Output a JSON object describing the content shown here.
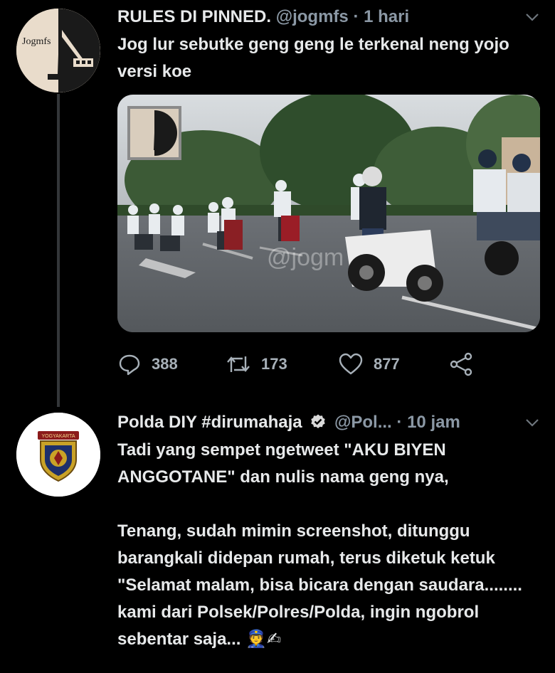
{
  "tweet1": {
    "avatar_text": "Jogmfs",
    "name": "RULES DI PINNED.",
    "handle": "@jogmfs",
    "separator": "·",
    "time": "1 hari",
    "text": "Jog lur sebutke geng geng le terkenal neng yojo versi koe",
    "media_watermark": "@jogm",
    "actions": {
      "reply_count": "388",
      "retweet_count": "173",
      "like_count": "877"
    }
  },
  "tweet2": {
    "name": "Polda DIY #dirumahaja",
    "handle": "@Pol...",
    "separator": "·",
    "time": "10 jam",
    "badge_text": "YOGYAKARTA",
    "paragraph1": "Tadi yang sempet ngetweet \"AKU BIYEN ANGGOTANE\" dan nulis nama geng nya,",
    "paragraph2": "Tenang, sudah mimin screenshot, ditunggu barangkali didepan rumah, terus diketuk ketuk \"Selamat malam, bisa bicara dengan saudara........ kami dari Polsek/Polres/Polda, ingin ngobrol sebentar saja...",
    "emoji": "👮✍"
  },
  "colors": {
    "background": "#000000",
    "text": "#e7e9ea",
    "muted": "#8b98a5",
    "thread_line": "#333639"
  }
}
